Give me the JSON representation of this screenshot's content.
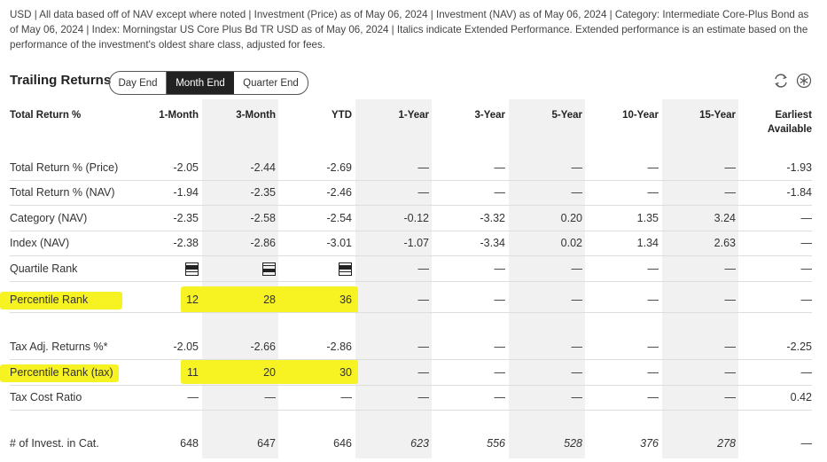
{
  "disclaimer": "USD | All data based off of NAV except where noted | Investment (Price) as of May 06, 2024 | Investment (NAV) as of May 06, 2024 | Category: Intermediate Core-Plus Bond as of May 06, 2024 | Index: Morningstar US Core Plus Bd TR USD as of May 06, 2024 | Italics indicate Extended Performance. Extended performance is an estimate based on the performance of the investment's oldest share class, adjusted for fees.",
  "section_title": "Trailing Returns",
  "toggle": {
    "day_end": "Day End",
    "month_end": "Month End",
    "quarter_end": "Quarter End",
    "selected": "Month End"
  },
  "icons": [
    "refresh-icon",
    "star-icon"
  ],
  "columns": {
    "label": "Total Return %",
    "c1": "1-Month",
    "c2": "3-Month",
    "c3": "YTD",
    "c4": "1-Year",
    "c5": "3-Year",
    "c6": "5-Year",
    "c7": "10-Year",
    "c8": "15-Year",
    "c9a": "Earliest",
    "c9b": "Available"
  },
  "rows": [
    {
      "label": "Total Return % (Price)",
      "v": [
        "-2.05",
        "-2.44",
        "-2.69",
        "—",
        "—",
        "—",
        "—",
        "—",
        "-1.93"
      ]
    },
    {
      "label": "Total Return % (NAV)",
      "v": [
        "-1.94",
        "-2.35",
        "-2.46",
        "—",
        "—",
        "—",
        "—",
        "—",
        "-1.84"
      ]
    },
    {
      "label": "Category (NAV)",
      "v": [
        "-2.35",
        "-2.58",
        "-2.54",
        "-0.12",
        "-3.32",
        "0.20",
        "1.35",
        "3.24",
        "—"
      ]
    },
    {
      "label": "Index (NAV)",
      "v": [
        "-2.38",
        "-2.86",
        "-3.01",
        "-1.07",
        "-3.34",
        "0.02",
        "1.34",
        "2.63",
        "—"
      ]
    },
    {
      "label": "Quartile Rank",
      "v": [
        "",
        "",
        "",
        "—",
        "—",
        "—",
        "—",
        "—",
        "—"
      ],
      "quartiles": [
        2,
        3,
        2
      ]
    },
    {
      "label": "Percentile Rank",
      "v": [
        "12",
        "28",
        "36",
        "—",
        "—",
        "—",
        "—",
        "—",
        "—"
      ]
    },
    {
      "label": "Tax Adj. Returns %*",
      "v": [
        "-2.05",
        "-2.66",
        "-2.86",
        "—",
        "—",
        "—",
        "—",
        "—",
        "-2.25"
      ]
    },
    {
      "label": "Percentile Rank (tax)",
      "v": [
        "11",
        "20",
        "30",
        "—",
        "—",
        "—",
        "—",
        "—",
        "—"
      ]
    },
    {
      "label": "Tax Cost Ratio",
      "v": [
        "—",
        "—",
        "—",
        "—",
        "—",
        "—",
        "—",
        "—",
        "0.42"
      ]
    },
    {
      "label": "# of Invest. in Cat.",
      "v": [
        "648",
        "647",
        "646",
        "623",
        "556",
        "528",
        "376",
        "278",
        "—"
      ]
    }
  ],
  "highlight_color": "#f7f221"
}
